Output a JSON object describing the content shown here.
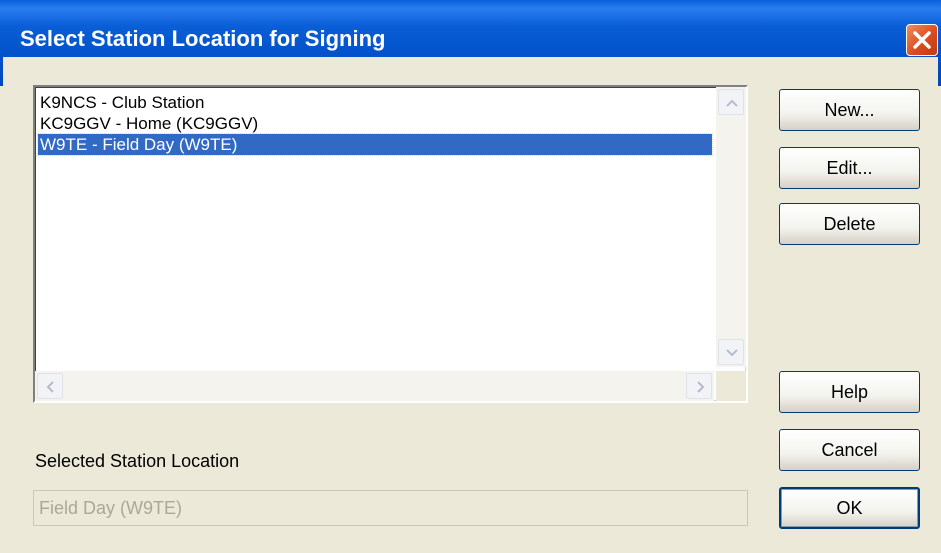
{
  "window": {
    "title": "Select Station Location for Signing"
  },
  "stations": {
    "items": [
      {
        "label": "K9NCS - Club Station",
        "selected": false
      },
      {
        "label": "KC9GGV - Home (KC9GGV)",
        "selected": false
      },
      {
        "label": "W9TE - Field Day (W9TE)",
        "selected": true
      }
    ]
  },
  "buttons": {
    "new": "New...",
    "edit": "Edit...",
    "delete": "Delete",
    "help": "Help",
    "cancel": "Cancel",
    "ok": "OK"
  },
  "selected_location": {
    "label": "Selected Station Location",
    "value": "Field Day (W9TE)"
  },
  "icons": {
    "close": "close-icon",
    "scroll_up": "chevron-up-icon",
    "scroll_down": "chevron-down-icon",
    "scroll_left": "chevron-left-icon",
    "scroll_right": "chevron-right-icon"
  },
  "colors": {
    "titlebar": "#0054e3",
    "selection": "#316ac5",
    "dialog_bg": "#ece9d8",
    "close_button": "#d8491d"
  }
}
